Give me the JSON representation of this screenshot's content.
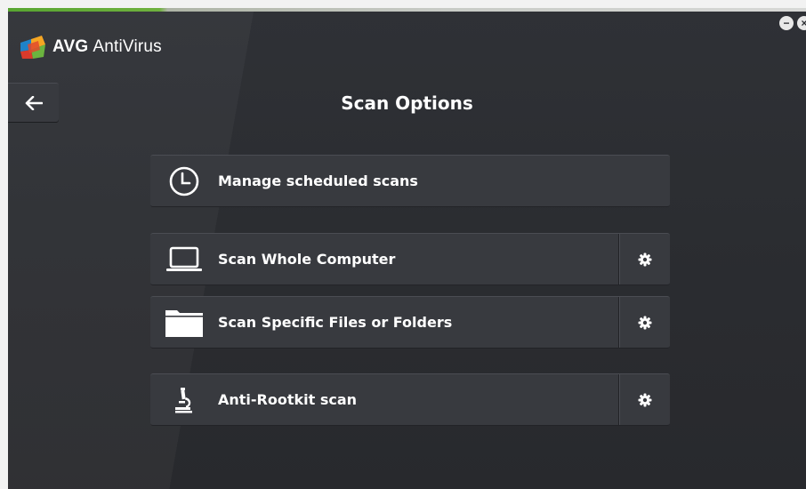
{
  "app": {
    "brand_bold": "AVG",
    "brand_rest": "AntiVirus"
  },
  "window": {
    "minimize_glyph": "−",
    "close_glyph": "×"
  },
  "page": {
    "title": "Scan Options"
  },
  "options": [
    {
      "label": "Manage scheduled scans",
      "icon": "clock-icon",
      "has_settings": false
    },
    {
      "label": "Scan Whole Computer",
      "icon": "laptop-icon",
      "has_settings": true
    },
    {
      "label": "Scan Specific Files or Folders",
      "icon": "folder-icon",
      "has_settings": true
    },
    {
      "label": "Anti-Rootkit scan",
      "icon": "microscope-icon",
      "has_settings": true
    }
  ],
  "colors": {
    "background": "#2b2d31",
    "panel": "#383a3f",
    "accent_green": "#58a531",
    "text": "#ffffff"
  }
}
